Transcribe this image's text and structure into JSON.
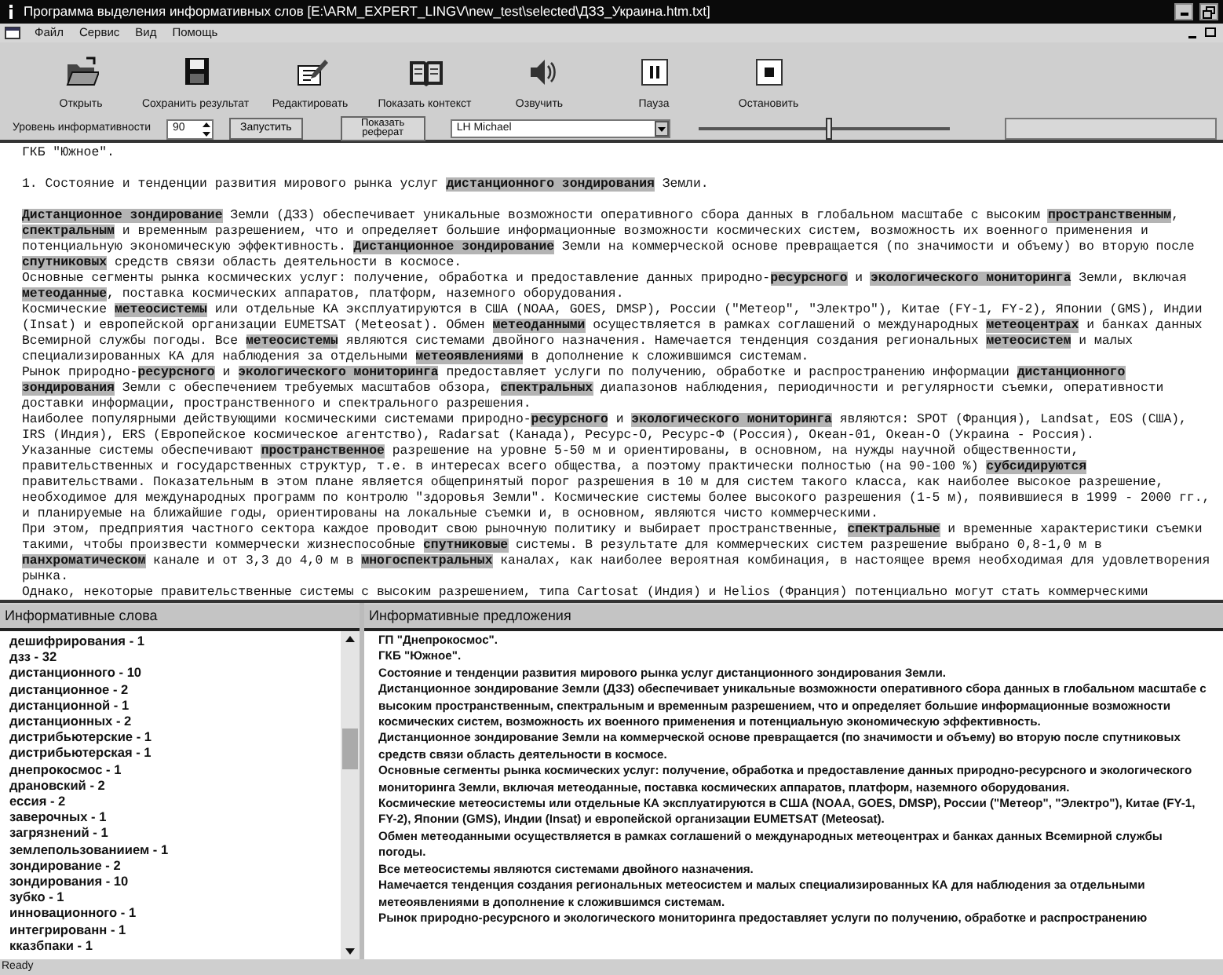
{
  "window": {
    "title": "Программа выделения информативных слов  [E:\\ARM_EXPERT_LINGV\\new_test\\selected\\ДЗЗ_Украина.htm.txt]"
  },
  "menu": [
    "Файл",
    "Сервис",
    "Вид",
    "Помощь"
  ],
  "toolbar": [
    {
      "label": "Открыть",
      "kind": "open"
    },
    {
      "label": "Сохранить результат",
      "kind": "save"
    },
    {
      "label": "Редактировать",
      "kind": "edit"
    },
    {
      "label": "Показать контекст",
      "kind": "book"
    },
    {
      "label": "Озвучить",
      "kind": "speak"
    },
    {
      "label": "Пауза",
      "kind": "pause"
    },
    {
      "label": "Остановить",
      "kind": "stop"
    }
  ],
  "controls": {
    "level_label": "Уровень информативности",
    "level_value": "90",
    "run_button": "Запустить",
    "abstract_button": "Показать реферат",
    "voice": "LH Michael",
    "speech_slider": {
      "level": 0.52
    }
  },
  "document": {
    "paragraphs": [
      {
        "gap_after": true,
        "segments": [
          {
            "text": "ГКБ \"Южное\".",
            "highlight": false
          }
        ]
      },
      {
        "gap_after": true,
        "segments": [
          {
            "text": "1. Состояние и тенденции развития мирового рынка услуг ",
            "highlight": false
          },
          {
            "text": "дистанционного зондирования",
            "highlight": true
          },
          {
            "text": " Земли.",
            "highlight": false
          }
        ]
      },
      {
        "gap_after": false,
        "segments": [
          {
            "text": "Дистанционное зондирование",
            "highlight": true
          },
          {
            "text": " Земли (ДЗЗ) обеспечивает уникальные возможности оперативного сбора данных в глобальном масштабе с высоким ",
            "highlight": false
          },
          {
            "text": "пространственным",
            "highlight": true
          },
          {
            "text": ", ",
            "highlight": false
          },
          {
            "text": "спектральным",
            "highlight": true
          },
          {
            "text": " и временным разрешением, что и определяет большие информационные возможности космических систем, возможность их военного применения и потенциальную экономическую эффективность. ",
            "highlight": false
          },
          {
            "text": "Дистанционное зондирование",
            "highlight": true
          },
          {
            "text": " Земли на коммерческой основе превращается (по значимости и объему) во вторую после ",
            "highlight": false
          },
          {
            "text": "спутниковых",
            "highlight": true
          },
          {
            "text": " средств связи область деятельности в космосе.",
            "highlight": false
          }
        ]
      },
      {
        "gap_after": false,
        "segments": [
          {
            "text": "Основные сегменты рынка космических услуг: получение, обработка и предоставление данных природно-",
            "highlight": false
          },
          {
            "text": "ресурсного",
            "highlight": true
          },
          {
            "text": " и ",
            "highlight": false
          },
          {
            "text": "экологического мониторинга",
            "highlight": true
          },
          {
            "text": " Земли, включая ",
            "highlight": false
          },
          {
            "text": "метеоданные",
            "highlight": true
          },
          {
            "text": ", поставка космических аппаратов, платформ, наземного оборудования.",
            "highlight": false
          }
        ]
      },
      {
        "gap_after": false,
        "segments": [
          {
            "text": "Космические ",
            "highlight": false
          },
          {
            "text": "метеосистемы",
            "highlight": true
          },
          {
            "text": " или отдельные КА эксплуатируются в США (NOAA, GOES, DMSP), России (\"Метеор\", \"Электро\"), Китае (FY-1, FY-2), Японии (GMS), Индии (Insat) и европейской организации EUMETSAT (Meteosat). Обмен ",
            "highlight": false
          },
          {
            "text": "метеоданными",
            "highlight": true
          },
          {
            "text": " осуществляется в рамках соглашений о международных ",
            "highlight": false
          },
          {
            "text": "метеоцентрах",
            "highlight": true
          },
          {
            "text": " и банках данных Всемирной службы погоды. Все ",
            "highlight": false
          },
          {
            "text": "метеосистемы",
            "highlight": true
          },
          {
            "text": " являются системами двойного назначения. Намечается тенденция создания региональных ",
            "highlight": false
          },
          {
            "text": "метеосистем",
            "highlight": true
          },
          {
            "text": " и малых специализированных КА для наблюдения за отдельными ",
            "highlight": false
          },
          {
            "text": "метеоявлениями",
            "highlight": true
          },
          {
            "text": " в дополнение к сложившимся системам.",
            "highlight": false
          }
        ]
      },
      {
        "gap_after": false,
        "segments": [
          {
            "text": "Рынок природно-",
            "highlight": false
          },
          {
            "text": "ресурсного",
            "highlight": true
          },
          {
            "text": " и ",
            "highlight": false
          },
          {
            "text": "экологического мониторинга",
            "highlight": true
          },
          {
            "text": " предоставляет услуги по получению, обработке и распространению информации ",
            "highlight": false
          },
          {
            "text": "дистанционного зондирования",
            "highlight": true
          },
          {
            "text": " Земли с обеспечением требуемых масштабов обзора, ",
            "highlight": false
          },
          {
            "text": "спектральных",
            "highlight": true
          },
          {
            "text": " диапазонов наблюдения, периодичности и регулярности съемки, оперативности доставки информации, пространственного и спектрального разрешения.",
            "highlight": false
          }
        ]
      },
      {
        "gap_after": false,
        "segments": [
          {
            "text": "Наиболее популярными действующими космическими системами природно-",
            "highlight": false
          },
          {
            "text": "ресурсного",
            "highlight": true
          },
          {
            "text": " и ",
            "highlight": false
          },
          {
            "text": "экологического мониторинга",
            "highlight": true
          },
          {
            "text": " являются: SPOT (Франция), Landsat, EOS (США), IRS (Индия), ERS (Европейское космическое агентство), Radarsat (Канада), Ресурс-О, Ресурс-Ф (Россия), Океан-01, Океан-О (Украина - Россия).",
            "highlight": false
          }
        ]
      },
      {
        "gap_after": false,
        "segments": [
          {
            "text": "Указанные системы обеспечивают ",
            "highlight": false
          },
          {
            "text": "пространственное",
            "highlight": true
          },
          {
            "text": " разрешение на уровне 5-50 м и ориентированы, в основном, на нужды научной общественности, правительственных и государственных структур, т.е. в интересах всего общества, а поэтому практически полностью (на 90-100 %) ",
            "highlight": false
          },
          {
            "text": "субсидируются",
            "highlight": true
          },
          {
            "text": " правительствами. Показательным в этом плане является общепринятый порог разрешения в 10 м для систем такого класса, как наиболее высокое разрешение, необходимое для международных программ по контролю \"здоровья Земли\". Космические системы более высокого разрешения (1-5 м), появившиеся в 1999 - 2000 гг., и планируемые на ближайшие годы, ориентированы на локальные съемки и, в основном, являются чисто коммерческими.",
            "highlight": false
          }
        ]
      },
      {
        "gap_after": false,
        "segments": [
          {
            "text": "При этом, предприятия частного сектора каждое проводит свою рыночную политику и выбирает пространственные, ",
            "highlight": false
          },
          {
            "text": "спектральные",
            "highlight": true
          },
          {
            "text": " и временные характеристики съемки такими, чтобы произвести коммерчески жизнеспособные ",
            "highlight": false
          },
          {
            "text": "спутниковые",
            "highlight": true
          },
          {
            "text": " системы. В результате для коммерческих систем разрешение выбрано 0,8-1,0 м в ",
            "highlight": false
          },
          {
            "text": "панхроматическом",
            "highlight": true
          },
          {
            "text": " канале и от 3,3 до 4,0 м в ",
            "highlight": false
          },
          {
            "text": "многоспектральных",
            "highlight": true
          },
          {
            "text": " каналах, как наиболее вероятная комбинация, в настоящее время необходимая для удовлетворения рынка.",
            "highlight": false
          }
        ]
      },
      {
        "gap_after": false,
        "segments": [
          {
            "text": "Однако, некоторые правительственные системы с высоким разрешением, типа Cartosat (Индия) и Helios (Франция) потенциально могут стать коммерческими",
            "highlight": false
          }
        ]
      }
    ]
  },
  "words_pane": {
    "title": "Информативные слова",
    "items": [
      "дешифрирования - 1",
      "дзз - 32",
      "дистанционного - 10",
      "дистанционное - 2",
      "дистанционной - 1",
      "дистанционных - 2",
      "дистрибьютерские - 1",
      "дистрибьютерская - 1",
      "днепрокосмос - 1",
      "драновский - 2",
      "ессия - 2",
      "заверочных - 1",
      "загрязнений - 1",
      "землепользованиием - 1",
      "зондирование - 2",
      "зондирования - 10",
      "зубко - 1",
      "инновационного - 1",
      "интегрированн - 1",
      "кказбпаки - 1"
    ]
  },
  "sentences_pane": {
    "title": "Информативные предложения",
    "items": [
      "ГП \"Днепрокосмос\".",
      "ГКБ \"Южное\".",
      "Состояние и тенденции развития мирового рынка услуг дистанционного зондирования Земли.",
      "Дистанционное зондирование Земли (ДЗЗ) обеспечивает уникальные возможности оперативного сбора данных в глобальном масштабе с высоким пространственным, спектральным и временным разрешением, что и определяет большие информационные возможности космических систем, возможность их военного применения и потенциальную экономическую эффективность.",
      "Дистанционное зондирование Земли на коммерческой основе превращается (по значимости и объему) во вторую после спутниковых средств связи область деятельности в космосе.",
      "Основные сегменты рынка космических услуг: получение, обработка и предоставление данных природно-ресурсного и экологического мониторинга Земли, включая метеоданные, поставка космических аппаратов, платформ, наземного оборудования.",
      "Космические метеосистемы или отдельные КА эксплуатируются в США (NOAA, GOES, DMSP), России (\"Метеор\", \"Электро\"), Китае (FY-1, FY-2), Японии (GMS), Индии (Insat) и европейской организации EUMETSAT (Meteosat).",
      "Обмен метеоданными осуществляется в рамках соглашений о международных метеоцентрах и банках данных Всемирной службы погоды.",
      "Все метеосистемы являются системами двойного назначения.",
      "Намечается тенденция создания региональных метеосистем и малых специализированных КА для наблюдения за отдельными метеоявлениями в дополнение к сложившимся системам.",
      "Рынок природно-ресурсного и экологического мониторинга предоставляет услуги по получению, обработке и распространению"
    ]
  },
  "status_bar": "Ready"
}
